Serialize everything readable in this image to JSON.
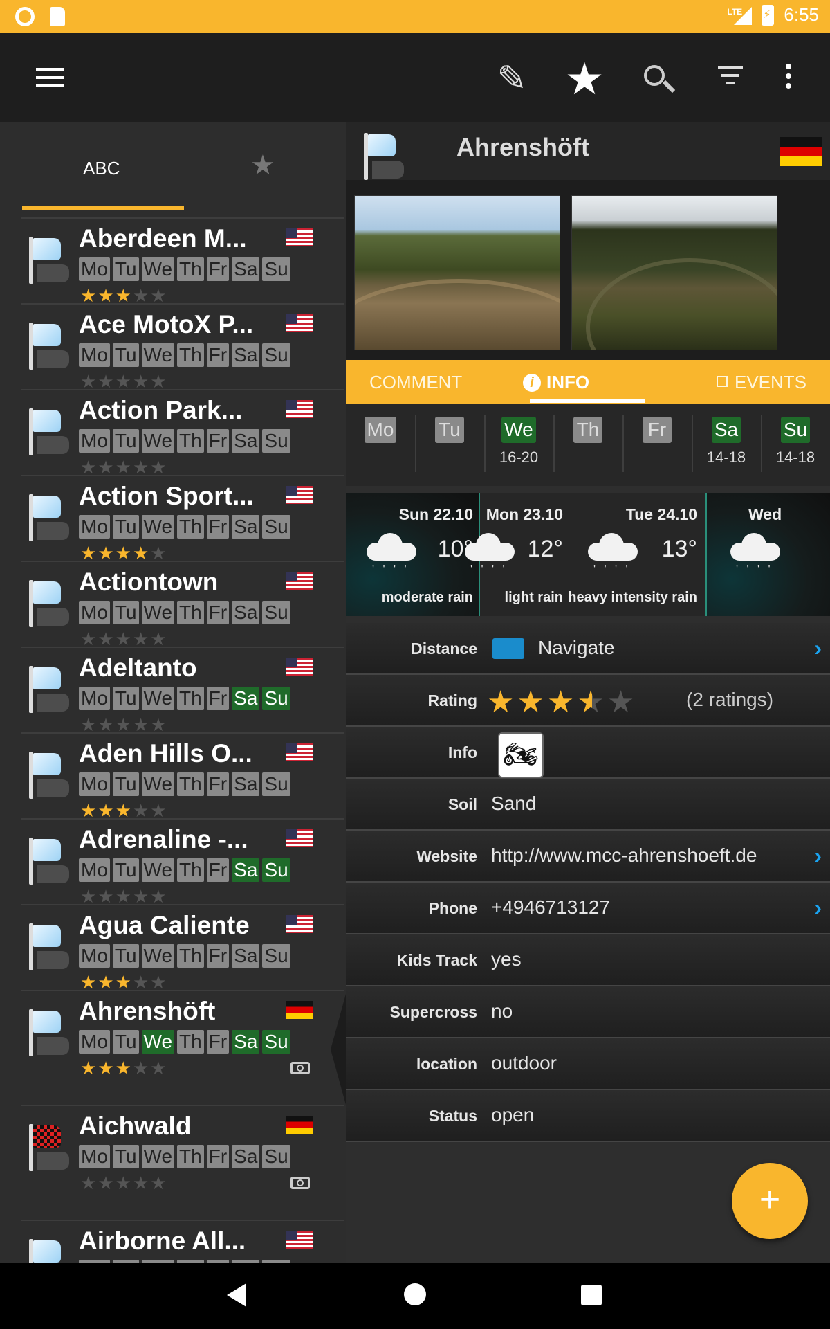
{
  "status_bar": {
    "time": "6:55",
    "network": "LTE"
  },
  "toolbar": {
    "icons": [
      "menu-icon",
      "pencil-icon",
      "star-icon",
      "search-icon",
      "filter-icon",
      "more-vert-icon"
    ]
  },
  "sort": {
    "label": "ABC"
  },
  "list": {
    "items": [
      {
        "name": "Aberdeen M...",
        "country": "US",
        "open_days": [],
        "rating": 3,
        "photo": false
      },
      {
        "name": "Ace MotoX P...",
        "country": "US",
        "open_days": [],
        "rating": 0,
        "photo": false
      },
      {
        "name": "Action Park...",
        "country": "US",
        "open_days": [],
        "rating": 0,
        "photo": false
      },
      {
        "name": "Action Sport...",
        "country": "US",
        "open_days": [],
        "rating": 4,
        "photo": false
      },
      {
        "name": "Actiontown",
        "country": "US",
        "open_days": [],
        "rating": 0,
        "photo": false
      },
      {
        "name": "Adeltanto",
        "country": "US",
        "open_days": [
          "Sa",
          "Su"
        ],
        "rating": 0,
        "photo": false
      },
      {
        "name": "Aden Hills O...",
        "country": "US",
        "open_days": [],
        "rating": 3,
        "photo": false
      },
      {
        "name": "Adrenaline -...",
        "country": "US",
        "open_days": [
          "Sa",
          "Su"
        ],
        "rating": 0,
        "photo": false
      },
      {
        "name": "Agua Caliente",
        "country": "US",
        "open_days": [],
        "rating": 3,
        "photo": false
      },
      {
        "name": "Ahrenshöft",
        "country": "DE",
        "open_days": [
          "We",
          "Sa",
          "Su"
        ],
        "rating": 3.5,
        "photo": true,
        "selected": true
      },
      {
        "name": "Aichwald",
        "country": "DE",
        "open_days": [],
        "rating": 0,
        "photo": true,
        "flag": "checker"
      },
      {
        "name": "Airborne All...",
        "country": "US",
        "open_days": [],
        "rating": 0,
        "photo": false
      }
    ],
    "day_labels": [
      "Mo",
      "Tu",
      "We",
      "Th",
      "Fr",
      "Sa",
      "Su"
    ]
  },
  "detail": {
    "title": "Ahrenshöft",
    "country": "DE",
    "tabs": {
      "comment": "COMMENT",
      "info": "INFO",
      "events": "EVENTS",
      "active": "info"
    },
    "week": [
      {
        "day": "Mo",
        "open": false,
        "hours": ""
      },
      {
        "day": "Tu",
        "open": false,
        "hours": ""
      },
      {
        "day": "We",
        "open": true,
        "hours": "16-20"
      },
      {
        "day": "Th",
        "open": false,
        "hours": ""
      },
      {
        "day": "Fr",
        "open": false,
        "hours": ""
      },
      {
        "day": "Sa",
        "open": true,
        "hours": "14-18"
      },
      {
        "day": "Su",
        "open": true,
        "hours": "14-18"
      }
    ],
    "weather": [
      {
        "date": "Sun 22.10",
        "temp": "10°",
        "desc": "moderate rain"
      },
      {
        "date": "Mon 23.10",
        "temp": "12°",
        "desc": "light rain"
      },
      {
        "date": "Tue 24.10",
        "temp": "13°",
        "desc": "heavy intensity rain"
      },
      {
        "date": "Wed",
        "temp": "",
        "desc": ""
      }
    ],
    "fields": {
      "distance_label": "Distance",
      "distance_value": "Navigate",
      "rating_label": "Rating",
      "rating_value": 3.5,
      "rating_count": "(2 ratings)",
      "info_label": "Info",
      "info_icon": "motocross-icon",
      "soil_label": "Soil",
      "soil_value": "Sand",
      "website_label": "Website",
      "website_value": "http://www.mcc-ahrenshoeft.de",
      "phone_label": "Phone",
      "phone_value": "+4946713127",
      "kids_label": "Kids Track",
      "kids_value": "yes",
      "supercross_label": "Supercross",
      "supercross_value": "no",
      "location_label": "location",
      "location_value": "outdoor",
      "status_label": "Status",
      "status_value": "open"
    }
  },
  "fab": {
    "label": "+"
  },
  "colors": {
    "accent": "#f9b62d",
    "open_day": "#1f6b2a",
    "closed_day": "#8a8a8a",
    "link": "#1aa3f0"
  }
}
